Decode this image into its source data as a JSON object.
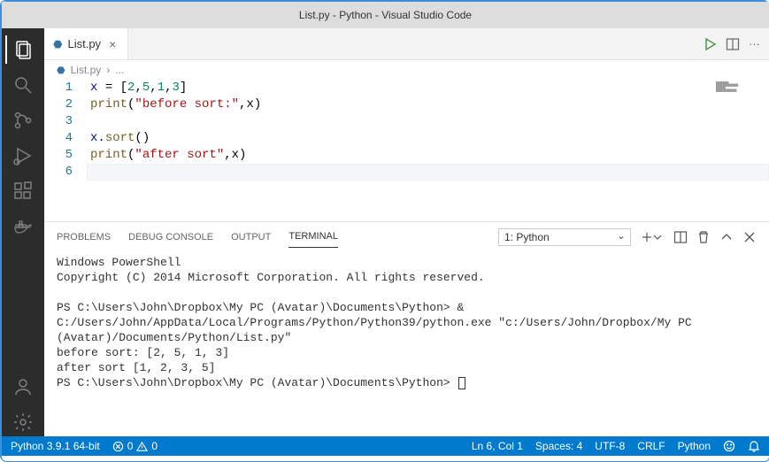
{
  "title": "List.py - Python - Visual Studio Code",
  "tab": {
    "filename": "List.py"
  },
  "breadcrumb": {
    "file": "List.py",
    "more": "..."
  },
  "line_numbers": [
    "1",
    "2",
    "3",
    "4",
    "5",
    "6"
  ],
  "code": {
    "l1": {
      "a": "x ",
      "b": "= [",
      "n1": "2",
      "c": ",",
      "n2": "5",
      "d": ",",
      "n3": "1",
      "e": ",",
      "n4": "3",
      "f": "]"
    },
    "l2": {
      "fn": "print",
      "a": "(",
      "s": "\"before sort:\"",
      "b": ",x)"
    },
    "l4": {
      "a": "x.",
      "fn": "sort",
      "b": "()"
    },
    "l5": {
      "fn": "print",
      "a": "(",
      "s": "\"after sort\"",
      "b": ",x)"
    }
  },
  "panel_tabs": {
    "problems": "PROBLEMS",
    "debug": "DEBUG CONSOLE",
    "output": "OUTPUT",
    "terminal": "TERMINAL"
  },
  "terminal_selector": "1: Python",
  "terminal": {
    "l1": "Windows PowerShell",
    "l2": "Copyright (C) 2014 Microsoft Corporation. All rights reserved.",
    "l3": "",
    "l4": "PS C:\\Users\\John\\Dropbox\\My PC (Avatar)\\Documents\\Python> & C:/Users/John/AppData/Local/Programs/Python/Python39/python.exe \"c:/Users/John/Dropbox/My PC (Avatar)/Documents/Python/List.py\"",
    "l5": "before sort: [2, 5, 1, 3]",
    "l6": "after sort [1, 2, 3, 5]",
    "l7": "PS C:\\Users\\John\\Dropbox\\My PC (Avatar)\\Documents\\Python> "
  },
  "status": {
    "python": "Python 3.9.1 64-bit",
    "errors": "0",
    "warnings": "0",
    "pos": "Ln 6, Col 1",
    "spaces": "Spaces: 4",
    "encoding": "UTF-8",
    "eol": "CRLF",
    "lang": "Python"
  }
}
